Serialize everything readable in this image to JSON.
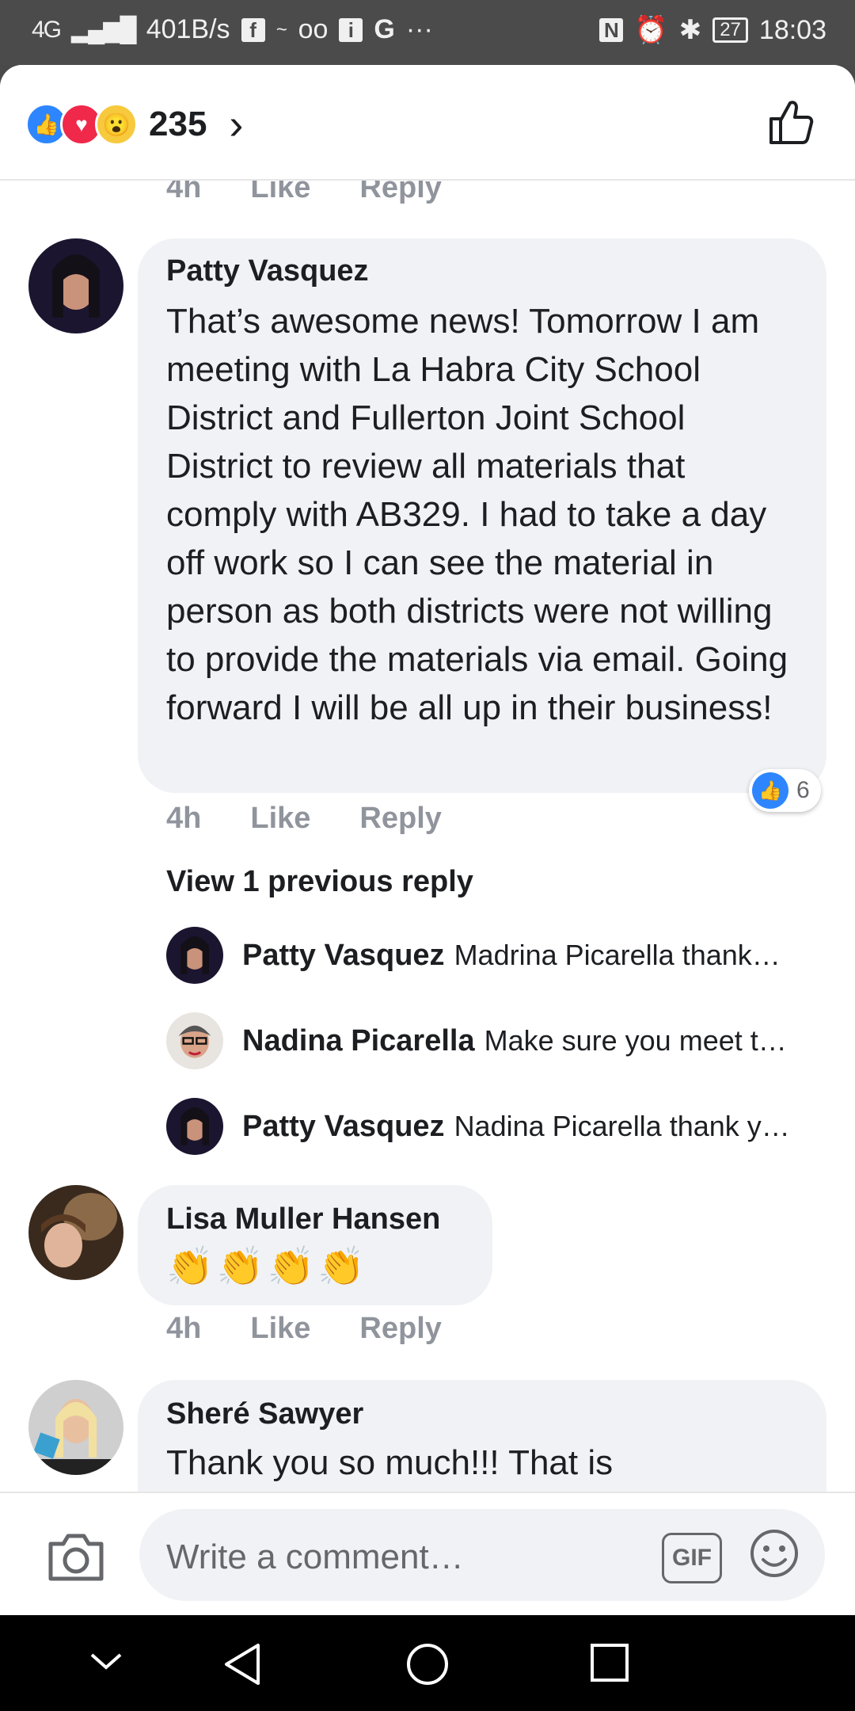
{
  "status_bar": {
    "network": "4G",
    "speed": "401B/s",
    "battery": "27",
    "time": "18:03"
  },
  "header": {
    "reaction_count": "235",
    "reactions": [
      "like-icon",
      "love-icon",
      "wow-icon"
    ]
  },
  "comments": [
    {
      "time": "4h",
      "like_label": "Like",
      "reply_label": "Reply"
    },
    {
      "author": "Patty Vasquez",
      "text": "That’s awesome news! Tomorrow I am meeting with La Habra City School District and Fullerton Joint School District to review all materials that comply with AB329. I had to take a day off work so I can see the material in person as both districts were not willing to provide the materials via email. Going forward I will be all up in their business!",
      "time": "4h",
      "like_label": "Like",
      "reply_label": "Reply",
      "like_count": "6",
      "view_previous": "View 1 previous reply",
      "replies": [
        {
          "author": "Patty Vasquez",
          "text": "Madrina Picarella thank…"
        },
        {
          "author": "Nadina Picarella",
          "text": "Make sure you meet t…"
        },
        {
          "author": "Patty Vasquez",
          "text": "Nadina Picarella thank y…"
        }
      ]
    },
    {
      "author": "Lisa Muller Hansen",
      "text": "👏👏👏👏",
      "time": "4h",
      "like_label": "Like",
      "reply_label": "Reply"
    },
    {
      "author": "Sheré Sawyer",
      "text": "Thank you so much!!! That is"
    }
  ],
  "composer": {
    "placeholder": "Write a comment…",
    "gif_label": "GIF"
  },
  "colors": {
    "accent": "#2d86ff",
    "bubble": "#f0f2f5",
    "meta": "#90949c"
  }
}
